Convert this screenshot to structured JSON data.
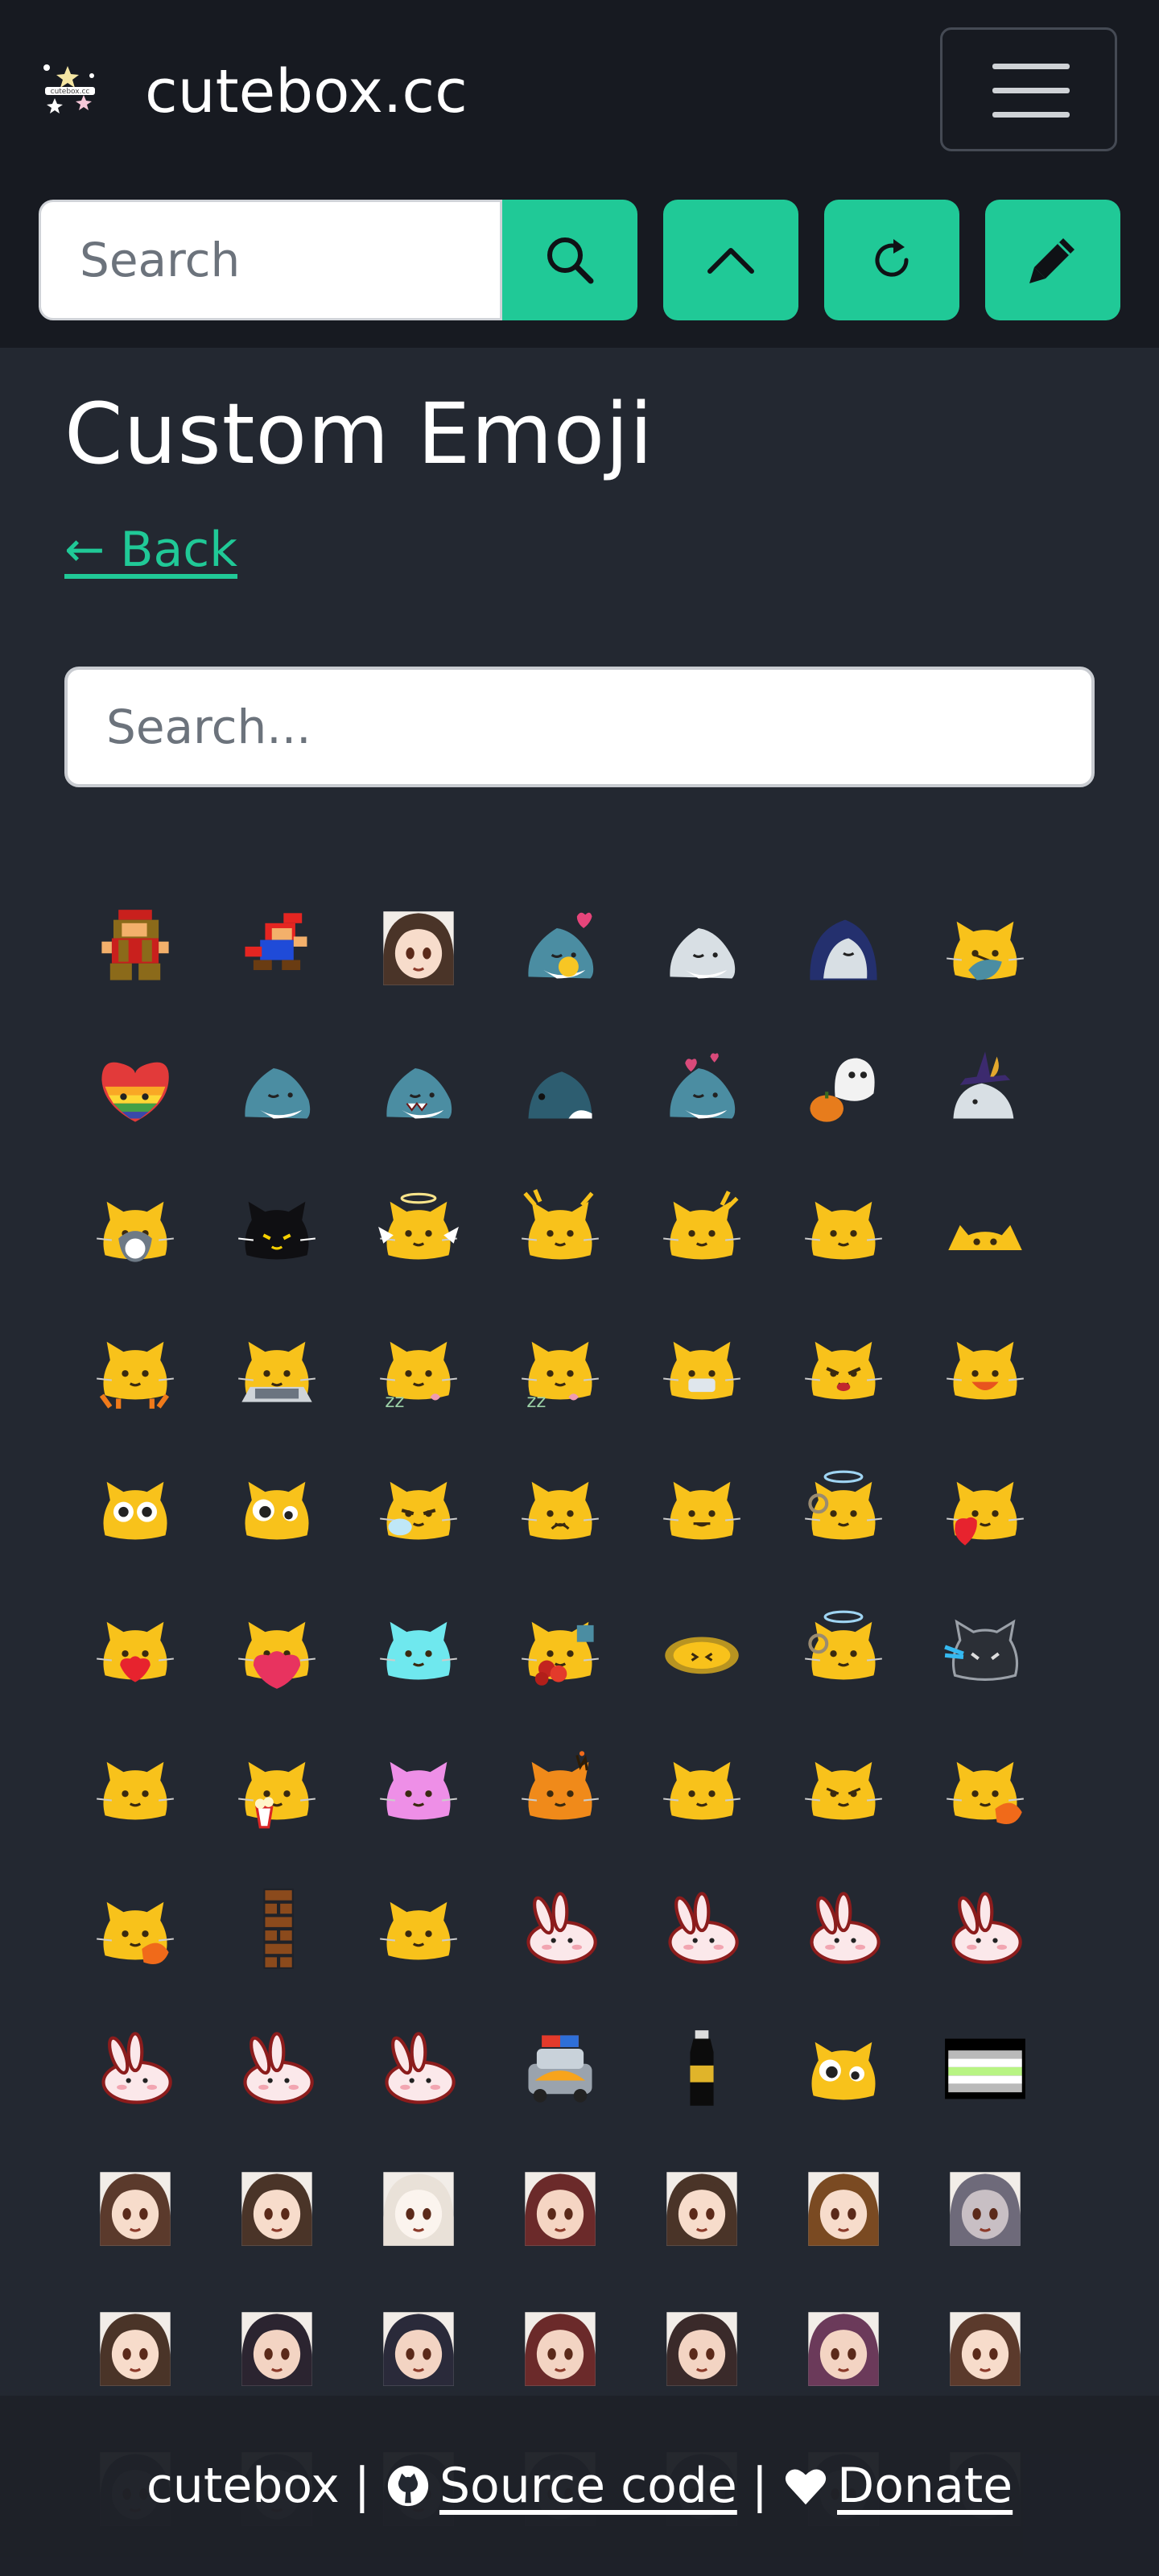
{
  "header": {
    "brand_name": "cutebox.cc",
    "search_placeholder": "Search"
  },
  "main": {
    "title": "Custom Emoji",
    "back_label": "← Back",
    "emoji_search_placeholder": "Search..."
  },
  "emojis": [
    "mario-8bit",
    "mario-jump",
    "anime-girl-sad",
    "shark-blob-heart",
    "shark-blob-smile",
    "shark-blob-hooded",
    "blobcat-hug-shark",
    "rainbow-heart-blob",
    "shark-blob",
    "shark-blob-teeth",
    "shark-blob-side",
    "shark-blob-love",
    "ghost-pumpkin",
    "shark-witch-hat",
    "blobcat-hug-penguin",
    "blobcat-black",
    "blobcat-angel",
    "blobcat-exclaim",
    "blobcat-surprised",
    "blobcat",
    "blobcat-peek",
    "blobcat-flop",
    "blobcat-laptop",
    "blobcat-sleep",
    "blobcat-sleep-2",
    "blobcat-mask",
    "blobcat-angry",
    "blobcat-happy",
    "blobcat-stare",
    "blobcat-googly",
    "blobcat-cry",
    "blobcat-sad",
    "blobcat-neutral",
    "blobcat-halo",
    "blobcat-heart",
    "blobcat-hug-heart",
    "blobcat-big-heart",
    "blobcat-cyan",
    "blobcat-flower",
    "blobcat-blurred",
    "blobcat-halo-2",
    "blobcat-outline-laugh",
    "blobcat-content",
    "blobcat-popcorn",
    "blobcat-pink",
    "blobcat-fire",
    "blobcat-think",
    "blobcat-grumpy",
    "blobcat-fox",
    "blobcat-fox-2",
    "brick-wall",
    "blobcat-smug",
    "bunny-blob",
    "bunny-blob-cry",
    "bunny-blob-happy",
    "bunny-blob-peek",
    "bunny-blob-2",
    "bunny-blob-3",
    "bunny-blob-wave",
    "police-car",
    "soda-bottle",
    "blobcat-googly-2",
    "flag-agender",
    "akko-happy",
    "akko-sleep",
    "akko-shocked",
    "akko-scared",
    "akko-cute",
    "akko-chibi",
    "akko-cry",
    "akko-laugh",
    "akko-sparkle",
    "akko-wand",
    "akko-hat",
    "akko-lying",
    "akko-blush",
    "akko-grin",
    "akko-dim-1",
    "akko-dim-2",
    "akko-dim-3",
    "akko-dim-4",
    "akko-dim-5",
    "akko-dim-6",
    "akko-dim-7"
  ],
  "footer": {
    "site": "cutebox",
    "divider": "|",
    "source_label": "Source code",
    "donate_label": "Donate"
  }
}
